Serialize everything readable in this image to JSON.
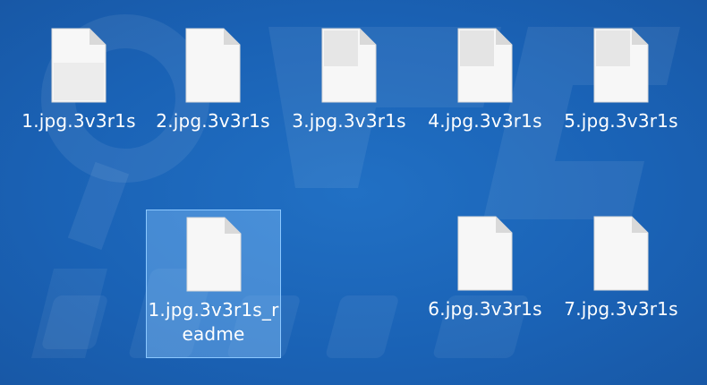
{
  "desktop": {
    "background_color": "#1a62b5",
    "selection_color": "#8cc8ff",
    "files": [
      {
        "name": "1.jpg.3v3r1s",
        "icon": "blank-file-icon",
        "selected": false
      },
      {
        "name": "2.jpg.3v3r1s",
        "icon": "blank-file-icon",
        "selected": false
      },
      {
        "name": "3.jpg.3v3r1s",
        "icon": "blank-file-icon",
        "selected": false
      },
      {
        "name": "4.jpg.3v3r1s",
        "icon": "blank-file-icon",
        "selected": false
      },
      {
        "name": "5.jpg.3v3r1s",
        "icon": "blank-file-icon",
        "selected": false
      },
      {
        "name": "1.jpg.3v3r1s_readme",
        "icon": "blank-file-icon",
        "selected": true
      },
      {
        "name": "6.jpg.3v3r1s",
        "icon": "blank-file-icon",
        "selected": false
      },
      {
        "name": "7.jpg.3v3r1s",
        "icon": "blank-file-icon",
        "selected": false
      }
    ]
  }
}
